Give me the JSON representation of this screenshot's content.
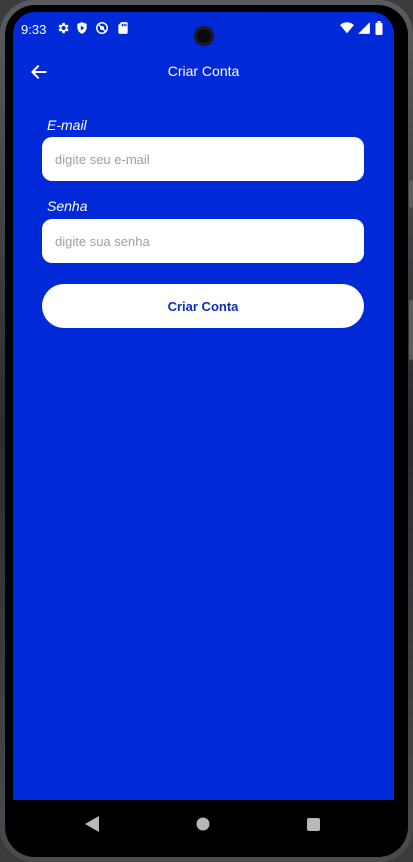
{
  "status_bar": {
    "time": "9:33",
    "icons": [
      "gear-icon",
      "shield-icon",
      "location-off-icon",
      "sd-card-icon",
      "wifi-icon",
      "signal-icon",
      "battery-icon"
    ]
  },
  "app_bar": {
    "title": "Criar Conta",
    "back_icon": "arrow-left-icon"
  },
  "form": {
    "email": {
      "label": "E-mail",
      "placeholder": "digite seu e-mail",
      "value": ""
    },
    "password": {
      "label": "Senha",
      "placeholder": "digite sua senha",
      "value": ""
    },
    "submit_label": "Criar Conta"
  },
  "nav_bar": {
    "icons": [
      "nav-back-icon",
      "nav-home-icon",
      "nav-recents-icon"
    ]
  },
  "colors": {
    "background": "#0029d8",
    "button_text": "#0b2fb8",
    "input_bg": "#ffffff",
    "nav_bar": "#000000"
  }
}
